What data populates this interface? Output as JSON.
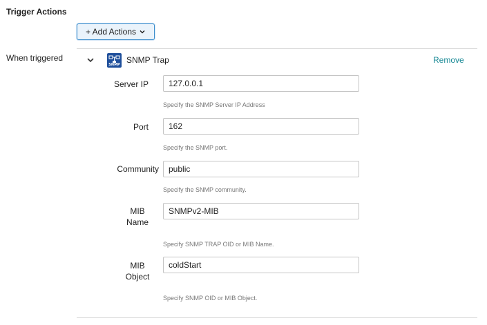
{
  "section": {
    "title": "Trigger Actions",
    "add_actions_label": "+ Add Actions",
    "when_label": "When triggered"
  },
  "action": {
    "icon": "snmp-icon",
    "icon_text": "SNMP",
    "title": "SNMP Trap",
    "remove_label": "Remove"
  },
  "fields": [
    {
      "label": "Server IP",
      "value": "127.0.0.1",
      "help": "Specify the SNMP Server IP Address"
    },
    {
      "label": "Port",
      "value": "162",
      "help": "Specify the SNMP port."
    },
    {
      "label": "Community",
      "value": "public",
      "help": "Specify the SNMP community."
    },
    {
      "label": "MIB\nName",
      "value": "SNMPv2-MIB",
      "help": "Specify SNMP TRAP OID or MIB Name."
    },
    {
      "label": "MIB\nObject",
      "value": "coldStart",
      "help": "Specify SNMP OID or MIB Object."
    }
  ],
  "colors": {
    "accent": "#3d8ecc",
    "link": "#1a8a96",
    "snmp_logo": "#1f4f9b"
  }
}
